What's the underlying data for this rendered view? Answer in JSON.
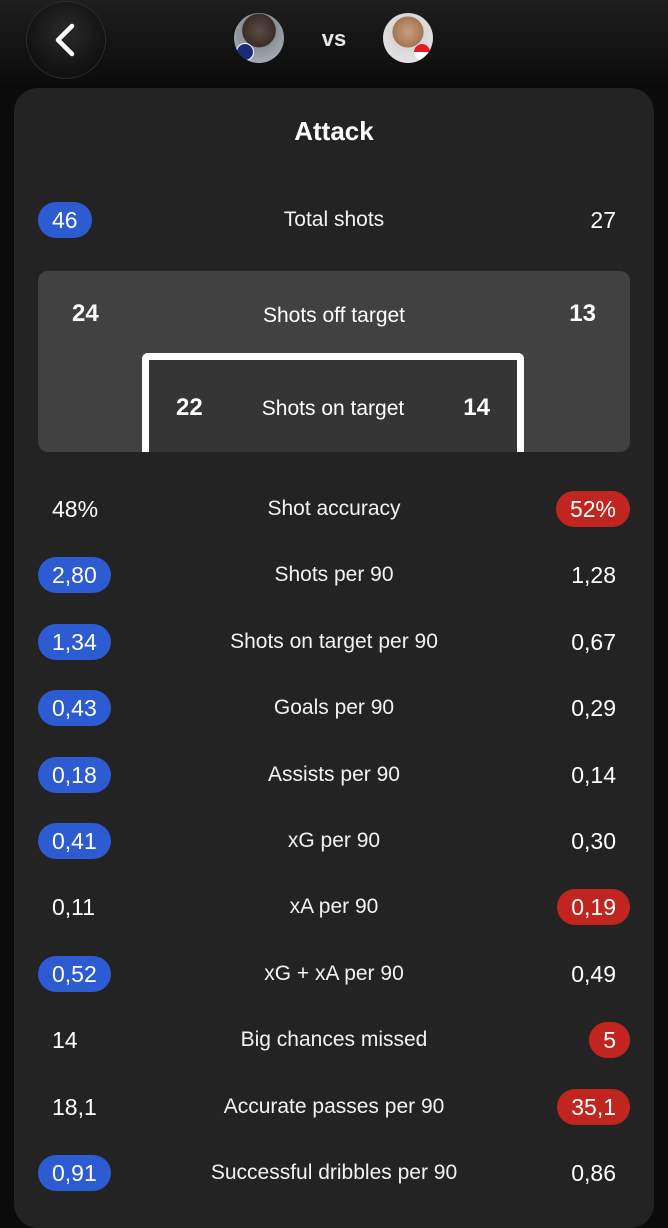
{
  "header": {
    "back_icon": "chevron-left-icon",
    "vs_label": "vs",
    "left_player_avatar": "player-avatar-inter",
    "right_player_avatar": "player-avatar-monaco"
  },
  "section_title": "Attack",
  "colors": {
    "left_accent": "#2d5bd2",
    "right_accent": "#c0261f",
    "card_bg": "#232323"
  },
  "total_shots": {
    "label": "Total shots",
    "left": "46",
    "right": "27",
    "left_highlight": "blue",
    "right_highlight": "none"
  },
  "shots_off_target": {
    "label": "Shots off target",
    "left": "24",
    "right": "13"
  },
  "shots_on_target": {
    "label": "Shots on target",
    "left": "22",
    "right": "14"
  },
  "stats": [
    {
      "label": "Shot accuracy",
      "left": "48%",
      "right": "52%",
      "left_highlight": "none",
      "right_highlight": "red"
    },
    {
      "label": "Shots per 90",
      "left": "2,80",
      "right": "1,28",
      "left_highlight": "blue",
      "right_highlight": "none"
    },
    {
      "label": "Shots on target per 90",
      "left": "1,34",
      "right": "0,67",
      "left_highlight": "blue",
      "right_highlight": "none"
    },
    {
      "label": "Goals per 90",
      "left": "0,43",
      "right": "0,29",
      "left_highlight": "blue",
      "right_highlight": "none"
    },
    {
      "label": "Assists per 90",
      "left": "0,18",
      "right": "0,14",
      "left_highlight": "blue",
      "right_highlight": "none"
    },
    {
      "label": "xG per 90",
      "left": "0,41",
      "right": "0,30",
      "left_highlight": "blue",
      "right_highlight": "none"
    },
    {
      "label": "xA per 90",
      "left": "0,11",
      "right": "0,19",
      "left_highlight": "none",
      "right_highlight": "red"
    },
    {
      "label": "xG + xA per 90",
      "left": "0,52",
      "right": "0,49",
      "left_highlight": "blue",
      "right_highlight": "none"
    },
    {
      "label": "Big chances missed",
      "left": "14",
      "right": "5",
      "left_highlight": "none",
      "right_highlight": "red"
    },
    {
      "label": "Accurate passes per 90",
      "left": "18,1",
      "right": "35,1",
      "left_highlight": "none",
      "right_highlight": "red"
    },
    {
      "label": "Successful dribbles per 90",
      "left": "0,91",
      "right": "0,86",
      "left_highlight": "blue",
      "right_highlight": "none"
    }
  ]
}
